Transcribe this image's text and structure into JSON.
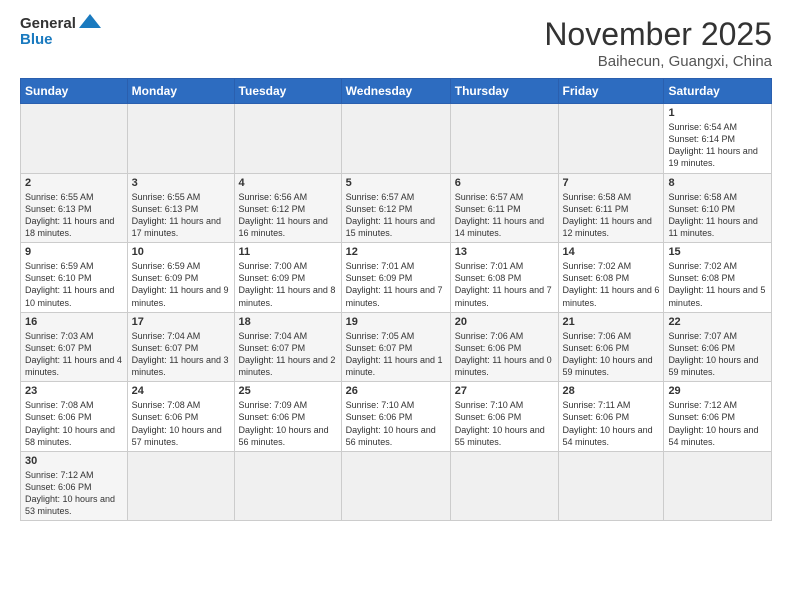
{
  "header": {
    "logo_general": "General",
    "logo_blue": "Blue",
    "month_title": "November 2025",
    "location": "Baihecun, Guangxi, China"
  },
  "weekdays": [
    "Sunday",
    "Monday",
    "Tuesday",
    "Wednesday",
    "Thursday",
    "Friday",
    "Saturday"
  ],
  "weeks": [
    [
      {
        "num": "",
        "info": ""
      },
      {
        "num": "",
        "info": ""
      },
      {
        "num": "",
        "info": ""
      },
      {
        "num": "",
        "info": ""
      },
      {
        "num": "",
        "info": ""
      },
      {
        "num": "",
        "info": ""
      },
      {
        "num": "1",
        "info": "Sunrise: 6:54 AM\nSunset: 6:14 PM\nDaylight: 11 hours and 19 minutes."
      }
    ],
    [
      {
        "num": "2",
        "info": "Sunrise: 6:55 AM\nSunset: 6:13 PM\nDaylight: 11 hours and 18 minutes."
      },
      {
        "num": "3",
        "info": "Sunrise: 6:55 AM\nSunset: 6:13 PM\nDaylight: 11 hours and 17 minutes."
      },
      {
        "num": "4",
        "info": "Sunrise: 6:56 AM\nSunset: 6:12 PM\nDaylight: 11 hours and 16 minutes."
      },
      {
        "num": "5",
        "info": "Sunrise: 6:57 AM\nSunset: 6:12 PM\nDaylight: 11 hours and 15 minutes."
      },
      {
        "num": "6",
        "info": "Sunrise: 6:57 AM\nSunset: 6:11 PM\nDaylight: 11 hours and 14 minutes."
      },
      {
        "num": "7",
        "info": "Sunrise: 6:58 AM\nSunset: 6:11 PM\nDaylight: 11 hours and 12 minutes."
      },
      {
        "num": "8",
        "info": "Sunrise: 6:58 AM\nSunset: 6:10 PM\nDaylight: 11 hours and 11 minutes."
      }
    ],
    [
      {
        "num": "9",
        "info": "Sunrise: 6:59 AM\nSunset: 6:10 PM\nDaylight: 11 hours and 10 minutes."
      },
      {
        "num": "10",
        "info": "Sunrise: 6:59 AM\nSunset: 6:09 PM\nDaylight: 11 hours and 9 minutes."
      },
      {
        "num": "11",
        "info": "Sunrise: 7:00 AM\nSunset: 6:09 PM\nDaylight: 11 hours and 8 minutes."
      },
      {
        "num": "12",
        "info": "Sunrise: 7:01 AM\nSunset: 6:09 PM\nDaylight: 11 hours and 7 minutes."
      },
      {
        "num": "13",
        "info": "Sunrise: 7:01 AM\nSunset: 6:08 PM\nDaylight: 11 hours and 7 minutes."
      },
      {
        "num": "14",
        "info": "Sunrise: 7:02 AM\nSunset: 6:08 PM\nDaylight: 11 hours and 6 minutes."
      },
      {
        "num": "15",
        "info": "Sunrise: 7:02 AM\nSunset: 6:08 PM\nDaylight: 11 hours and 5 minutes."
      }
    ],
    [
      {
        "num": "16",
        "info": "Sunrise: 7:03 AM\nSunset: 6:07 PM\nDaylight: 11 hours and 4 minutes."
      },
      {
        "num": "17",
        "info": "Sunrise: 7:04 AM\nSunset: 6:07 PM\nDaylight: 11 hours and 3 minutes."
      },
      {
        "num": "18",
        "info": "Sunrise: 7:04 AM\nSunset: 6:07 PM\nDaylight: 11 hours and 2 minutes."
      },
      {
        "num": "19",
        "info": "Sunrise: 7:05 AM\nSunset: 6:07 PM\nDaylight: 11 hours and 1 minute."
      },
      {
        "num": "20",
        "info": "Sunrise: 7:06 AM\nSunset: 6:06 PM\nDaylight: 11 hours and 0 minutes."
      },
      {
        "num": "21",
        "info": "Sunrise: 7:06 AM\nSunset: 6:06 PM\nDaylight: 10 hours and 59 minutes."
      },
      {
        "num": "22",
        "info": "Sunrise: 7:07 AM\nSunset: 6:06 PM\nDaylight: 10 hours and 59 minutes."
      }
    ],
    [
      {
        "num": "23",
        "info": "Sunrise: 7:08 AM\nSunset: 6:06 PM\nDaylight: 10 hours and 58 minutes."
      },
      {
        "num": "24",
        "info": "Sunrise: 7:08 AM\nSunset: 6:06 PM\nDaylight: 10 hours and 57 minutes."
      },
      {
        "num": "25",
        "info": "Sunrise: 7:09 AM\nSunset: 6:06 PM\nDaylight: 10 hours and 56 minutes."
      },
      {
        "num": "26",
        "info": "Sunrise: 7:10 AM\nSunset: 6:06 PM\nDaylight: 10 hours and 56 minutes."
      },
      {
        "num": "27",
        "info": "Sunrise: 7:10 AM\nSunset: 6:06 PM\nDaylight: 10 hours and 55 minutes."
      },
      {
        "num": "28",
        "info": "Sunrise: 7:11 AM\nSunset: 6:06 PM\nDaylight: 10 hours and 54 minutes."
      },
      {
        "num": "29",
        "info": "Sunrise: 7:12 AM\nSunset: 6:06 PM\nDaylight: 10 hours and 54 minutes."
      }
    ],
    [
      {
        "num": "30",
        "info": "Sunrise: 7:12 AM\nSunset: 6:06 PM\nDaylight: 10 hours and 53 minutes."
      },
      {
        "num": "",
        "info": ""
      },
      {
        "num": "",
        "info": ""
      },
      {
        "num": "",
        "info": ""
      },
      {
        "num": "",
        "info": ""
      },
      {
        "num": "",
        "info": ""
      },
      {
        "num": "",
        "info": ""
      }
    ]
  ]
}
